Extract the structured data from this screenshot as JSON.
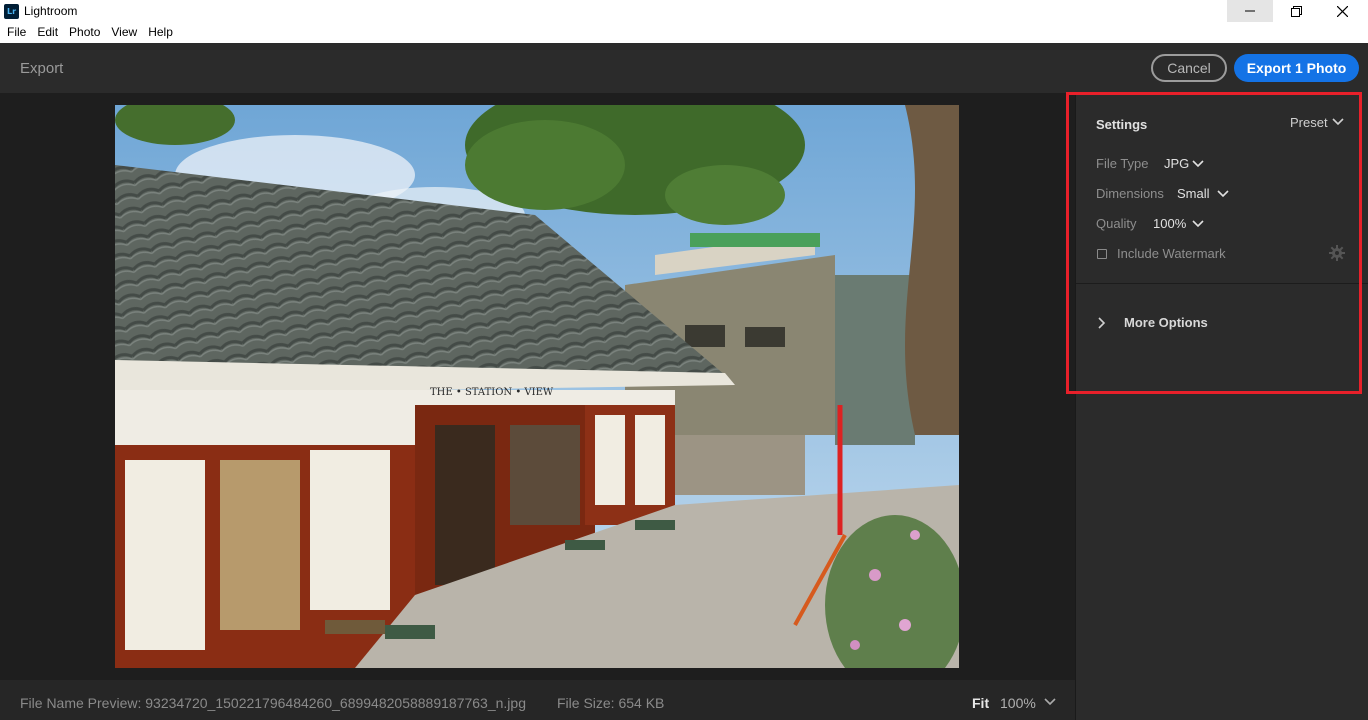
{
  "window": {
    "app_icon_text": "Lr",
    "title": "Lightroom"
  },
  "menu": [
    "File",
    "Edit",
    "Photo",
    "View",
    "Help"
  ],
  "header": {
    "title": "Export",
    "cancel_label": "Cancel",
    "export_label": "Export 1 Photo"
  },
  "photo": {
    "sign_text": "THE • STATION • VIEW"
  },
  "footer": {
    "file_name_preview": "File Name Preview: 93234720_150221796484260_6899482058889187763_n.jpg",
    "file_size": "File Size: 654 KB",
    "fit_label": "Fit",
    "zoom_value": "100%"
  },
  "settings": {
    "title": "Settings",
    "preset_label": "Preset",
    "file_type_label": "File Type",
    "file_type_value": "JPG",
    "dimensions_label": "Dimensions",
    "dimensions_value": "Small",
    "quality_label": "Quality",
    "quality_value": "100%",
    "watermark_label": "Include Watermark",
    "more_options_label": "More Options"
  },
  "colors": {
    "accent": "#1473e6",
    "highlight": "#e8202a",
    "panel_bg": "#2b2b2b"
  }
}
